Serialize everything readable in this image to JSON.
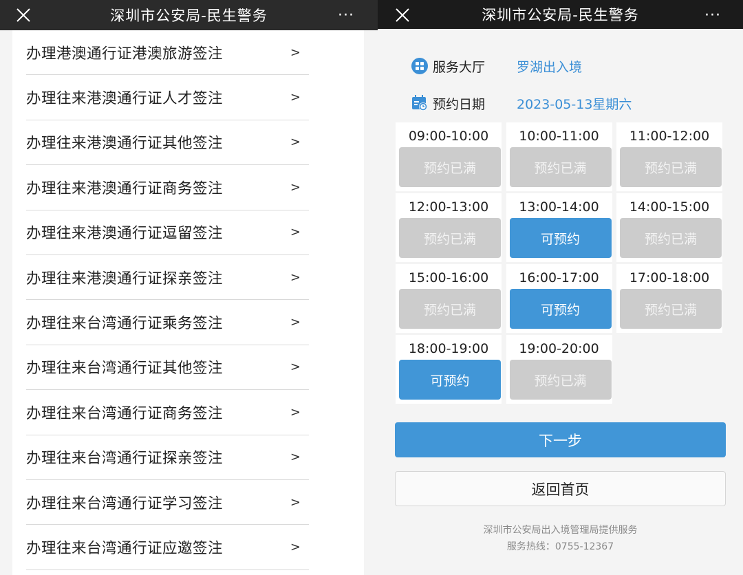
{
  "left": {
    "title": "深圳市公安局-民生警务",
    "more": "···",
    "close_icon": "close-icon",
    "items": [
      {
        "label": "办理港澳通行证港澳旅游签注",
        "arrow": ">"
      },
      {
        "label": "办理往来港澳通行证人才签注",
        "arrow": ">"
      },
      {
        "label": "办理往来港澳通行证其他签注",
        "arrow": ">"
      },
      {
        "label": "办理往来港澳通行证商务签注",
        "arrow": ">"
      },
      {
        "label": "办理往来港澳通行证逗留签注",
        "arrow": ">"
      },
      {
        "label": "办理往来港澳通行证探亲签注",
        "arrow": ">"
      },
      {
        "label": "办理往来台湾通行证乘务签注",
        "arrow": ">"
      },
      {
        "label": "办理往来台湾通行证其他签注",
        "arrow": ">"
      },
      {
        "label": "办理往来台湾通行证商务签注",
        "arrow": ">"
      },
      {
        "label": "办理往来台湾通行证探亲签注",
        "arrow": ">"
      },
      {
        "label": "办理往来台湾通行证学习签注",
        "arrow": ">"
      },
      {
        "label": "办理往来台湾通行证应邀签注",
        "arrow": ">"
      }
    ]
  },
  "right": {
    "title": "深圳市公安局-民生警务",
    "more": "···",
    "hall_label": "服务大厅",
    "hall_value": "罗湖出入境",
    "date_label": "预约日期",
    "date_value": "2023-05-13星期六",
    "accent_color": "#4196d7",
    "full_color": "#cccccc",
    "slots": [
      {
        "time": "09:00-10:00",
        "status": "预约已满",
        "available": false
      },
      {
        "time": "10:00-11:00",
        "status": "预约已满",
        "available": false
      },
      {
        "time": "11:00-12:00",
        "status": "预约已满",
        "available": false
      },
      {
        "time": "12:00-13:00",
        "status": "预约已满",
        "available": false
      },
      {
        "time": "13:00-14:00",
        "status": "可预约",
        "available": true
      },
      {
        "time": "14:00-15:00",
        "status": "预约已满",
        "available": false
      },
      {
        "time": "15:00-16:00",
        "status": "预约已满",
        "available": false
      },
      {
        "time": "16:00-17:00",
        "status": "可预约",
        "available": true
      },
      {
        "time": "17:00-18:00",
        "status": "预约已满",
        "available": false
      },
      {
        "time": "18:00-19:00",
        "status": "可预约",
        "available": true
      },
      {
        "time": "19:00-20:00",
        "status": "预约已满",
        "available": false
      }
    ],
    "next_label": "下一步",
    "home_label": "返回首页",
    "footer_line1": "深圳市公安局出入境管理局提供服务",
    "footer_line2": "服务热线：0755-12367"
  }
}
